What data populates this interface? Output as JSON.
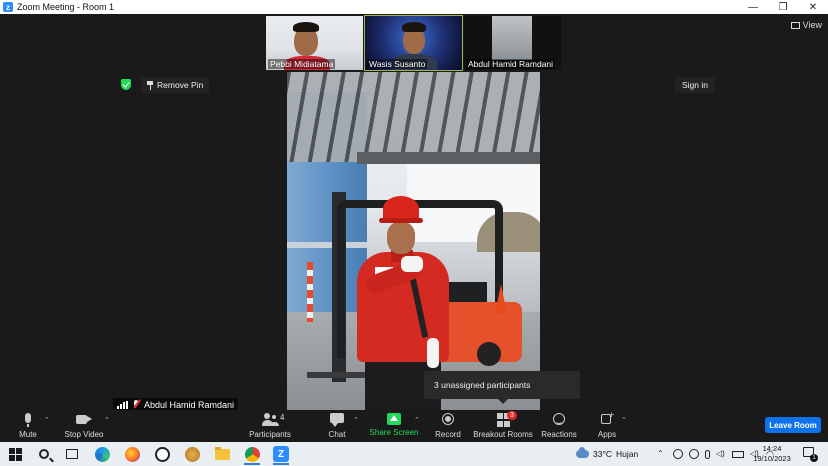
{
  "window": {
    "title": "Zoom Meeting - Room 1",
    "controls": {
      "minimize": "—",
      "restore": "❐",
      "close": "✕"
    }
  },
  "view": {
    "label": "View"
  },
  "gallery": [
    {
      "name": "Pebbi Midiatama",
      "active": false
    },
    {
      "name": "Wasis Susanto",
      "active": true
    },
    {
      "name": "Abdul Hamid Ramdani",
      "active": false
    }
  ],
  "pin": {
    "label": "Remove Pin"
  },
  "signin": {
    "label": "Sign in"
  },
  "main_video": {
    "name": "Abdul Hamid Ramdani",
    "mic_muted": true
  },
  "tooltip": {
    "text": "3 unassigned participants"
  },
  "toolbar": {
    "mute": "Mute",
    "stop_video": "Stop Video",
    "participants": "Participants",
    "participants_count": "4",
    "chat": "Chat",
    "share_screen": "Share Screen",
    "record": "Record",
    "breakout_rooms": "Breakout Rooms",
    "breakout_badge": "3",
    "reactions": "Reactions",
    "apps": "Apps",
    "leave": "Leave Room"
  },
  "taskbar": {
    "weather_temp": "33°C",
    "weather_text": "Hujan",
    "time": "14:24",
    "date": "19/10/2023",
    "notif_count": "1"
  },
  "colors": {
    "accent": "#2D8CFF",
    "leave": "#0e72ed",
    "share": "#23d959",
    "badge": "#e02828"
  }
}
